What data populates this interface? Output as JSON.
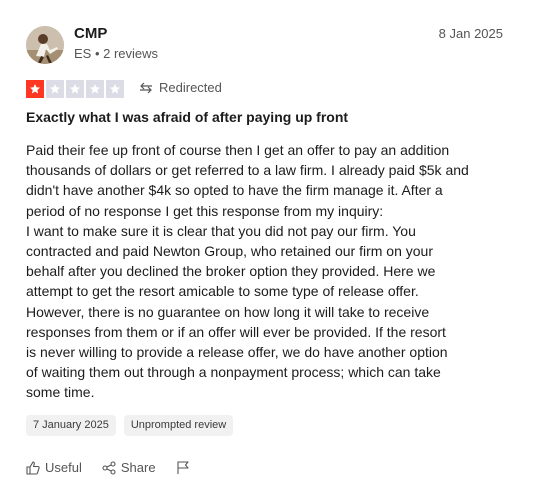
{
  "reviewer": {
    "name": "CMP",
    "country": "ES",
    "reviews": "2 reviews",
    "meta_separator": " • "
  },
  "review": {
    "date_top": "8 Jan 2025",
    "rating": 1,
    "max_rating": 5,
    "source_label": "Redirected",
    "title": "Exactly what I was afraid of after paying up front",
    "body": "Paid their fee up front of course then I get an offer to pay an addition\nthousands of dollars or get referred to a law firm. I already paid $5k and\ndidn't have another $4k so opted to have the firm manage it. After a\nperiod of no response I get this response from my inquiry:\nI want to make sure it is clear that you did not pay our firm. You\ncontracted and paid Newton Group, who retained our firm on your\nbehalf after you declined the broker option they provided. Here we\nattempt to get the resort amicable to some type of release offer.\nHowever, there is no guarantee on how long it will take to receive\nresponses from them or if an offer will ever be provided. If the resort\nis never willing to provide a release offer, we do have another option\nof waiting them out through a nonpayment process; which can take\nsome time.",
    "tags": [
      "7 January 2025",
      "Unprompted review"
    ]
  },
  "actions": {
    "useful_label": "Useful",
    "share_label": "Share"
  },
  "colors": {
    "star_filled": "#ff3722",
    "star_empty": "#dcdce6"
  }
}
